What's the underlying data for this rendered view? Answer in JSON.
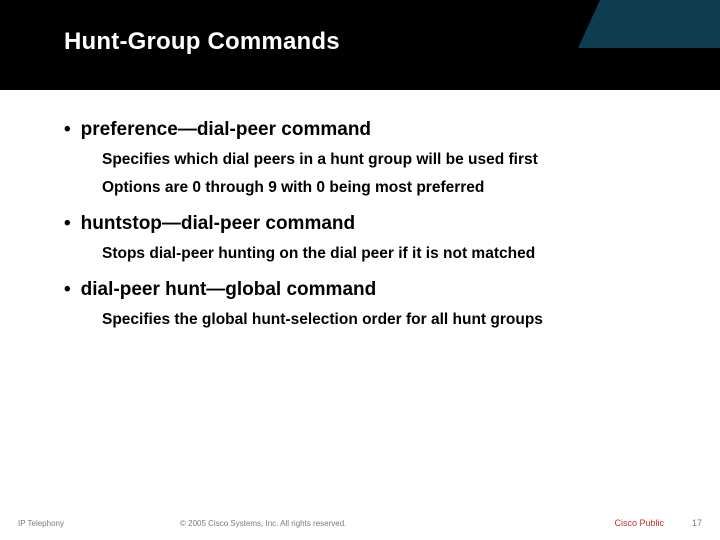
{
  "title": "Hunt-Group Commands",
  "bullets": [
    {
      "heading": "preference—dial-peer command",
      "subs": [
        "Specifies which dial peers in a hunt group will be used first",
        "Options are 0 through 9 with 0 being most preferred"
      ]
    },
    {
      "heading": "huntstop—dial-peer command",
      "subs": [
        "Stops dial-peer hunting on the dial peer if it is not matched"
      ]
    },
    {
      "heading": "dial-peer hunt—global command",
      "subs": [
        "Specifies the global hunt-selection order for all hunt groups"
      ]
    }
  ],
  "footer": {
    "left": "IP Telephony",
    "center": "© 2005 Cisco Systems, Inc. All rights reserved.",
    "right": "Cisco Public",
    "page": "17"
  }
}
